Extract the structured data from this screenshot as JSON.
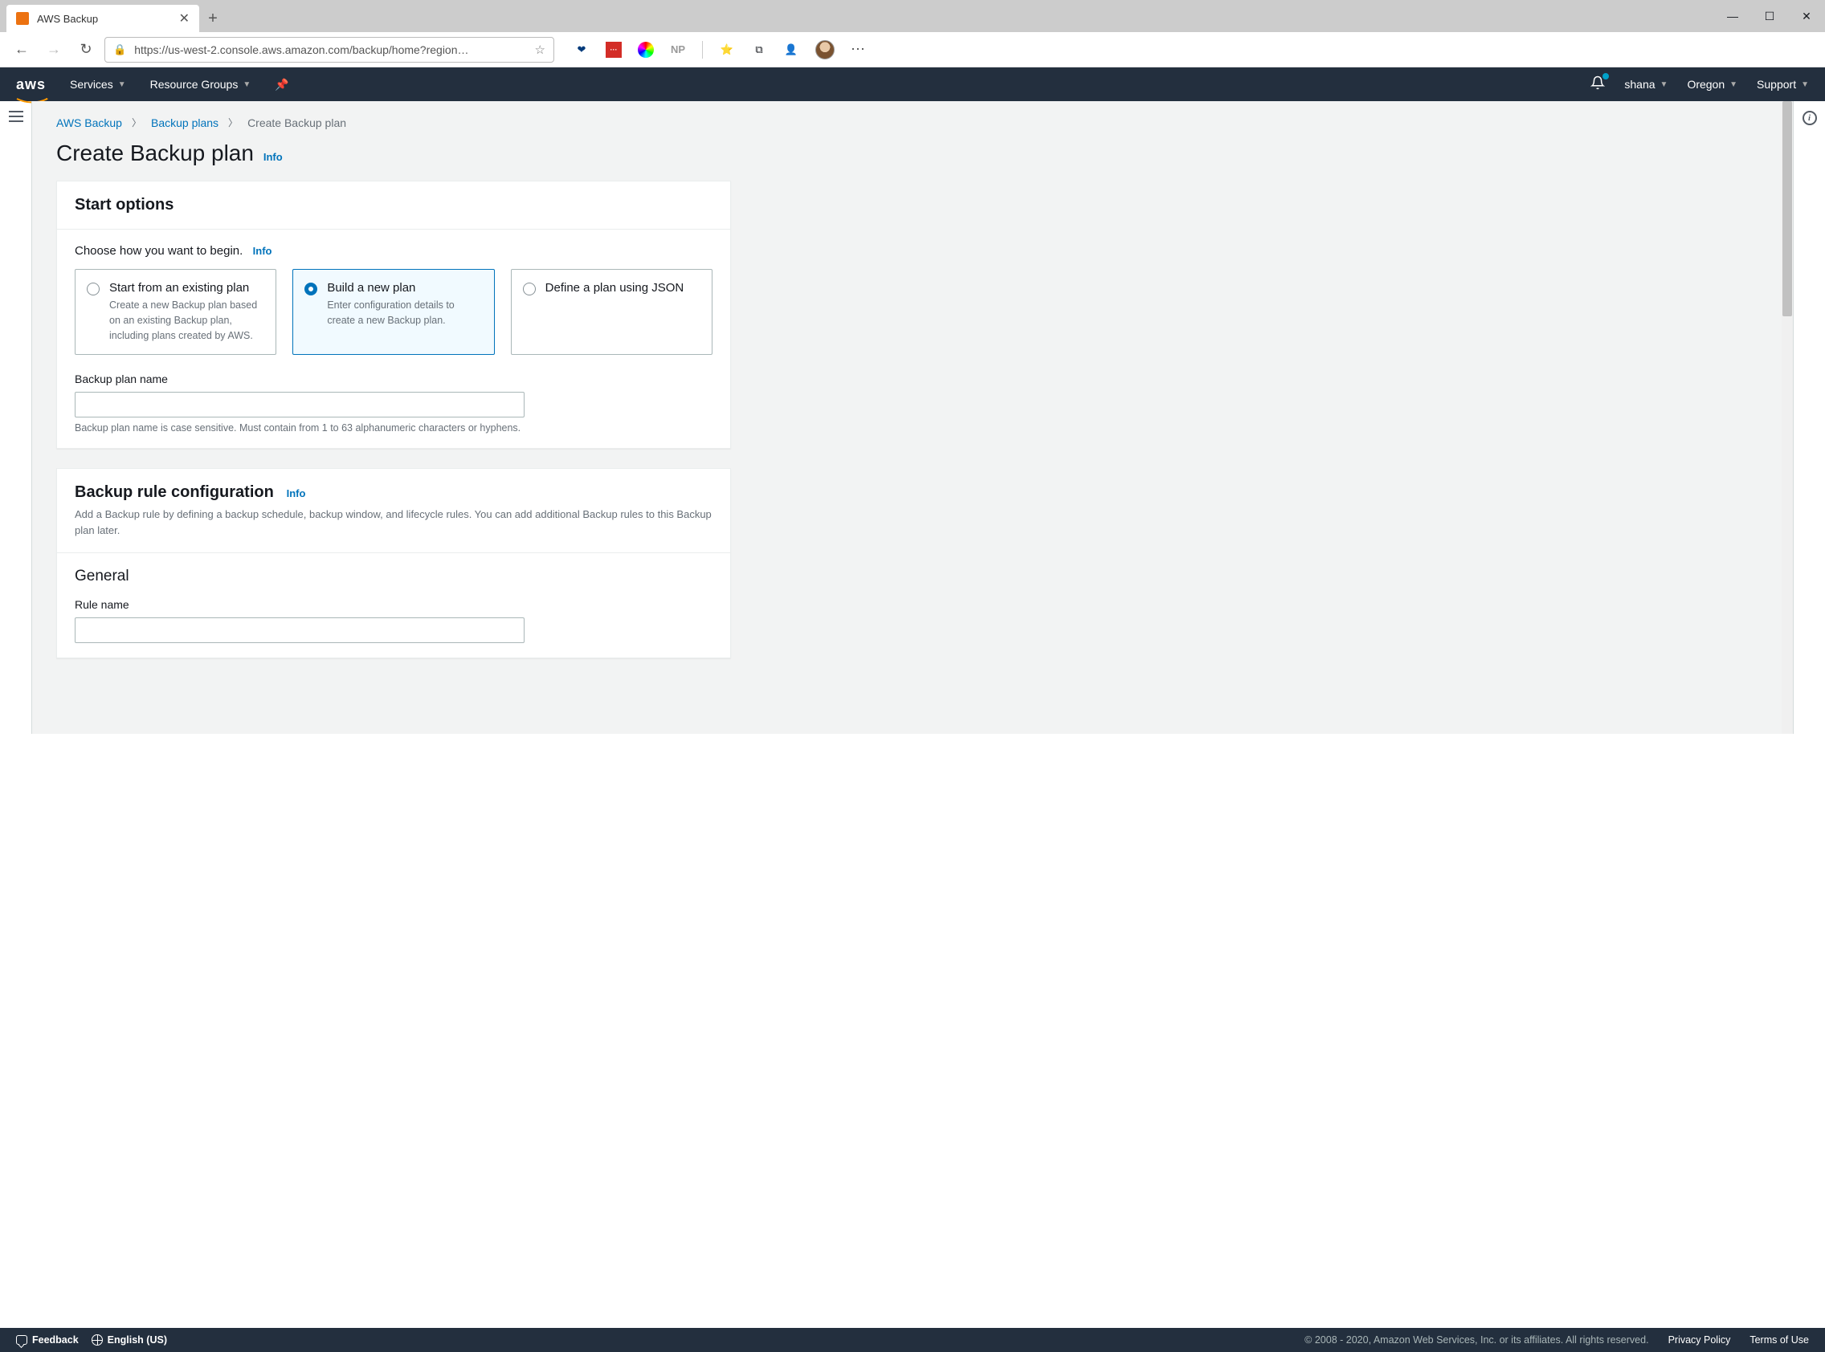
{
  "browser": {
    "tab_title": "AWS Backup",
    "url": "https://us-west-2.console.aws.amazon.com/backup/home?region…",
    "ext_np": "NP"
  },
  "nav": {
    "services": "Services",
    "resource_groups": "Resource Groups",
    "user": "shana",
    "region": "Oregon",
    "support": "Support"
  },
  "breadcrumb": {
    "l1": "AWS Backup",
    "l2": "Backup plans",
    "l3": "Create Backup plan"
  },
  "page": {
    "title": "Create Backup plan",
    "info": "Info"
  },
  "start_options": {
    "header": "Start options",
    "prompt": "Choose how you want to begin.",
    "info": "Info",
    "tiles": [
      {
        "title": "Start from an existing plan",
        "desc": "Create a new Backup plan based on an existing Backup plan, including plans created by AWS."
      },
      {
        "title": "Build a new plan",
        "desc": "Enter configuration details to create a new Backup plan."
      },
      {
        "title": "Define a plan using JSON",
        "desc": ""
      }
    ],
    "name_label": "Backup plan name",
    "name_value": "",
    "name_hint": "Backup plan name is case sensitive. Must contain from 1 to 63 alphanumeric characters or hyphens."
  },
  "rule_config": {
    "header": "Backup rule configuration",
    "info": "Info",
    "desc": "Add a Backup rule by defining a backup schedule, backup window, and lifecycle rules. You can add additional Backup rules to this Backup plan later.",
    "general": "General",
    "rule_name_label": "Rule name",
    "rule_name_value": ""
  },
  "footer": {
    "feedback": "Feedback",
    "language": "English (US)",
    "copyright": "© 2008 - 2020, Amazon Web Services, Inc. or its affiliates. All rights reserved.",
    "privacy": "Privacy Policy",
    "terms": "Terms of Use"
  }
}
